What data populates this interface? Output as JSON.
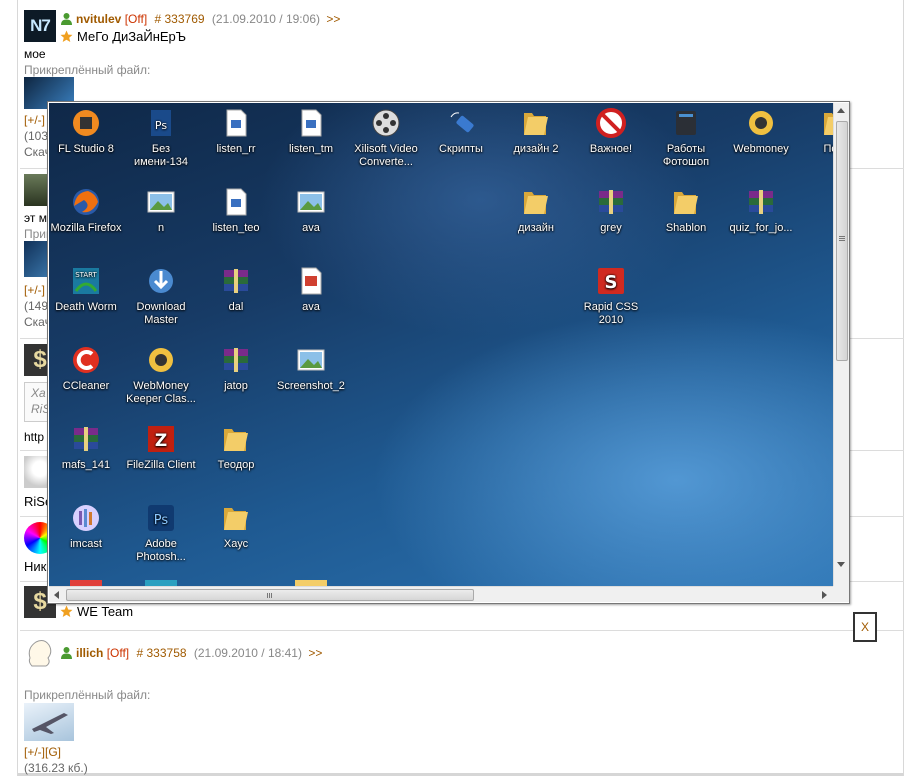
{
  "posts": [
    {
      "username": "nvitulev",
      "status_off": "[Off]",
      "post_id": "# 333769",
      "date": "(21.09.2010 / 19:06)",
      "more": ">>",
      "user_status": "МеГо ДиЗаЙнЕрЪ",
      "avatar_text": "N7",
      "message": "мое",
      "attachment_label": "Прикреплённый файл:",
      "controls": "[+/-]",
      "size_partial": "(103",
      "download_partial": "Скач"
    },
    {
      "controls": "[+/-]",
      "size_partial": "(149",
      "download_partial": "Скач",
      "message_partial": "эт м",
      "attach_partial": "Прик"
    },
    {
      "quote_partial_1": "Ха",
      "quote_partial_2": "RiS",
      "link_partial": "http"
    },
    {
      "name_partial": "RiSe"
    },
    {
      "name_partial": "Ник"
    },
    {
      "user_status": "WE Team"
    },
    {
      "username": "illich",
      "status_off": "[Off]",
      "post_id": "# 333758",
      "date": "(21.09.2010 / 18:41)",
      "more": ">>",
      "attachment_label": "Прикреплённый файл:",
      "controls": "[+/-][G]",
      "size": "(316.23 кб.)"
    }
  ],
  "desktop_icons": [
    {
      "label": "FL Studio 8",
      "icon": "fl-studio-icon"
    },
    {
      "label": "Без имени-134",
      "icon": "psd-file-icon"
    },
    {
      "label": "listen_rr",
      "icon": "audio-file-icon"
    },
    {
      "label": "listen_tm",
      "icon": "audio-file-icon"
    },
    {
      "label": "Xilisoft Video Converte...",
      "icon": "film-reel-icon"
    },
    {
      "label": "Скрипты",
      "icon": "usb-drive-icon"
    },
    {
      "label": "дизайн 2",
      "icon": "folder-icon"
    },
    {
      "label": "Важное!",
      "icon": "no-entry-icon"
    },
    {
      "label": "Работы Фотошоп",
      "icon": "dark-folder-icon"
    },
    {
      "label": "Webmoney",
      "icon": "webmoney-icon"
    },
    {
      "label": "Порт",
      "icon": "folder-icon"
    },
    {
      "label": "Mozilla Firefox",
      "icon": "firefox-icon"
    },
    {
      "label": "n",
      "icon": "image-file-icon"
    },
    {
      "label": "listen_teo",
      "icon": "audio-file-icon"
    },
    {
      "label": "ava",
      "icon": "image-file-icon"
    },
    {
      "label": "дизайн",
      "icon": "folder-icon"
    },
    {
      "label": "grey",
      "icon": "winrar-icon"
    },
    {
      "label": "Shablon",
      "icon": "folder-icon"
    },
    {
      "label": "quiz_for_jo...",
      "icon": "winrar-icon"
    },
    {
      "label": "Death Worm",
      "icon": "game-icon"
    },
    {
      "label": "Download Master",
      "icon": "download-master-icon"
    },
    {
      "label": "dal",
      "icon": "winrar-icon"
    },
    {
      "label": "ava",
      "icon": "presentation-file-icon"
    },
    {
      "label": "Rapid CSS 2010",
      "icon": "rapid-css-icon"
    },
    {
      "label": "CCleaner",
      "icon": "ccleaner-icon"
    },
    {
      "label": "WebMoney Keeper Clas...",
      "icon": "webmoney-icon"
    },
    {
      "label": "jatop",
      "icon": "winrar-icon"
    },
    {
      "label": "Screenshot_2",
      "icon": "image-file-icon"
    },
    {
      "label": "mafs_141",
      "icon": "winrar-icon"
    },
    {
      "label": "FileZilla Client",
      "icon": "filezilla-icon"
    },
    {
      "label": "Теодор",
      "icon": "folder-icon"
    },
    {
      "label": "imcast",
      "icon": "imcast-icon"
    },
    {
      "label": "Adobe Photosh...",
      "icon": "photoshop-icon"
    },
    {
      "label": "Хаус",
      "icon": "folder-icon"
    }
  ],
  "close_label": "X",
  "colors": {
    "link": "#a05a00",
    "off": "#cc3300",
    "meta": "#888888"
  }
}
